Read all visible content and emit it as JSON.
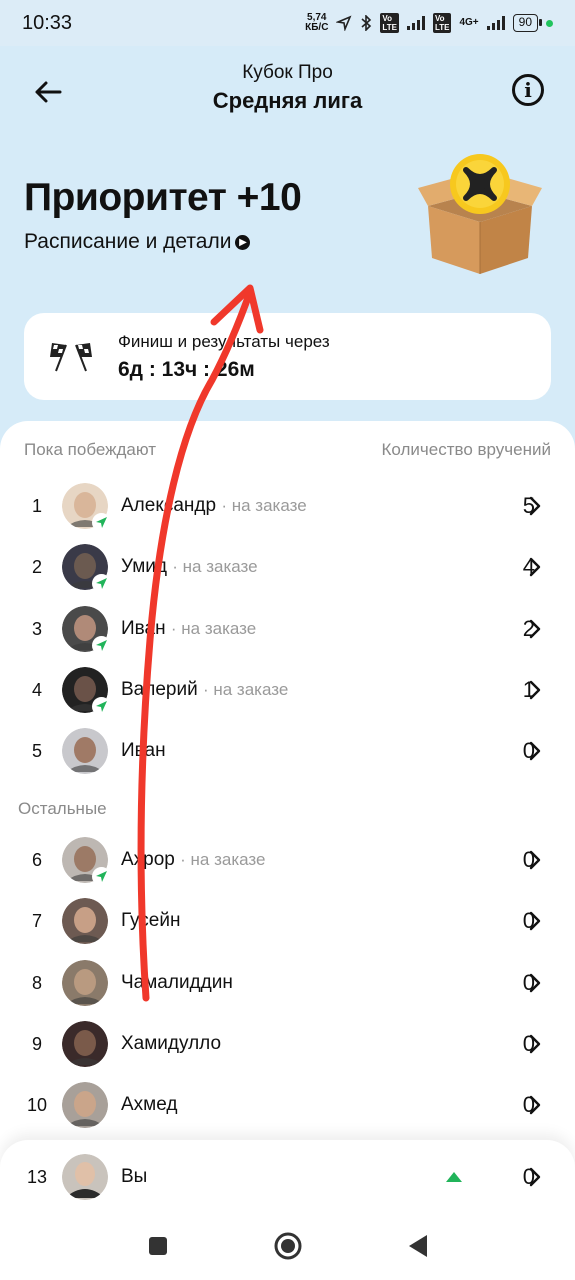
{
  "status_bar": {
    "time": "10:33",
    "speed_value": "5,74",
    "speed_unit": "КБ/С",
    "network": "4G+",
    "battery": "90"
  },
  "header": {
    "subtitle": "Кубок Про",
    "title": "Средняя лига"
  },
  "hero": {
    "priority": "Приоритет +10",
    "schedule_link": "Расписание и детали"
  },
  "timer": {
    "label": "Финиш и результаты через",
    "value": "6д : 13ч : 26м"
  },
  "winners_section": {
    "title": "Пока побеждают",
    "column": "Количество вручений"
  },
  "others_section": {
    "title": "Остальные"
  },
  "rows": [
    {
      "rank": "1",
      "name": "Александр",
      "status": "· на заказе",
      "count": "5"
    },
    {
      "rank": "2",
      "name": "Умид",
      "status": "· на заказе",
      "count": "4"
    },
    {
      "rank": "3",
      "name": "Иван",
      "status": "· на заказе",
      "count": "2"
    },
    {
      "rank": "4",
      "name": "Валерий",
      "status": "· на заказе",
      "count": "1"
    },
    {
      "rank": "5",
      "name": "Иван",
      "status": "",
      "count": "0"
    },
    {
      "rank": "6",
      "name": "Ахрор",
      "status": "· на заказе",
      "count": "0"
    },
    {
      "rank": "7",
      "name": "Гусейн",
      "status": "",
      "count": "0"
    },
    {
      "rank": "8",
      "name": "Чамалиддин",
      "status": "",
      "count": "0"
    },
    {
      "rank": "9",
      "name": "Хамидулло",
      "status": "",
      "count": "0"
    },
    {
      "rank": "10",
      "name": "Ахмед",
      "status": "",
      "count": "0"
    }
  ],
  "you": {
    "rank": "13",
    "name": "Вы",
    "count": "0"
  },
  "colors": {
    "header_bg": "#d6ebf8",
    "accent_green": "#21b45a",
    "annotation_red": "#f0382b",
    "coin_yellow": "#f7c81e"
  }
}
